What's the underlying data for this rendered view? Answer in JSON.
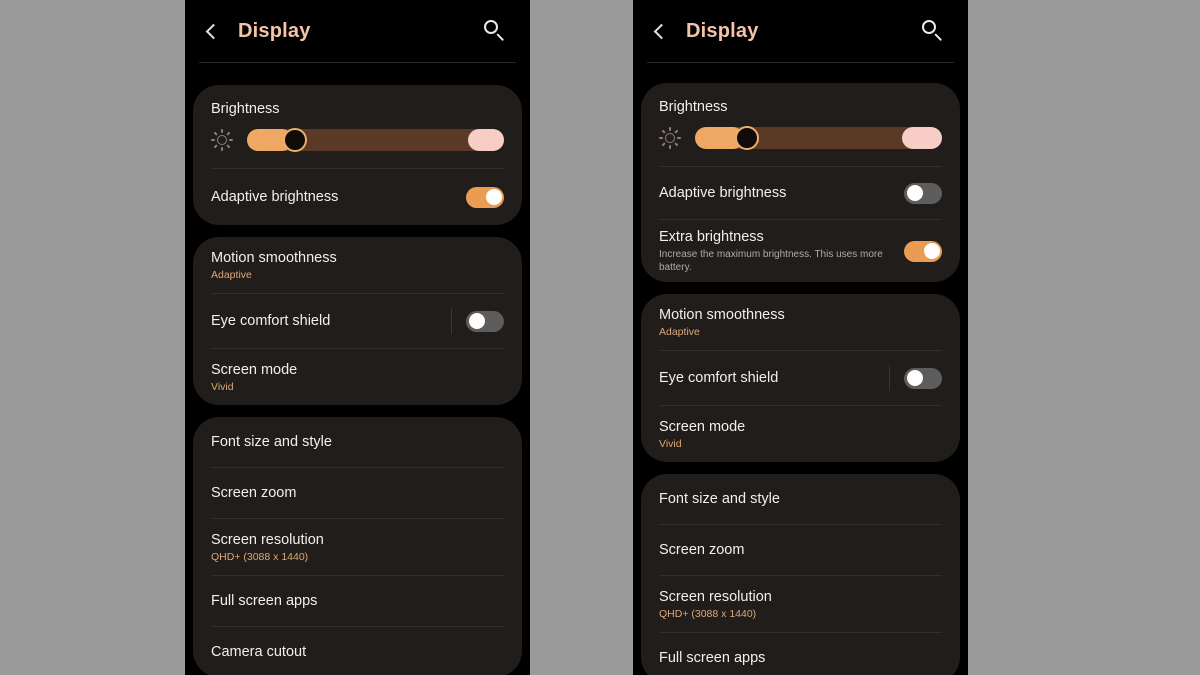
{
  "background_color": "#9a9a9a",
  "theme": {
    "screen_bg": "#000000",
    "card_bg": "#211d1a",
    "title_accent": "#f6c3a8",
    "sub_accent": "#dda878",
    "toggle_on": "#ea9d52",
    "toggle_off": "#5d5d5d",
    "slider_fill": "#efa863",
    "slider_track": "#5a3a26",
    "slider_cap": "#f7cdc6"
  },
  "left_phone": {
    "header": {
      "back_icon": "chevron-left-icon",
      "title": "Display",
      "search_icon": "search-icon"
    },
    "brightness": {
      "label": "Brightness",
      "icon": "brightness-sun-icon",
      "slider": {
        "fill_percent": 18,
        "knob_percent": 17,
        "cap_percent": 14
      }
    },
    "adaptive_brightness": {
      "label": "Adaptive brightness",
      "toggle": "on"
    },
    "card2": [
      {
        "label": "Motion smoothness",
        "sub": "Adaptive",
        "control": "none"
      },
      {
        "label": "Eye comfort shield",
        "sub": "",
        "control": "toggle",
        "toggle": "off",
        "divider_before_toggle": true
      },
      {
        "label": "Screen mode",
        "sub": "Vivid",
        "control": "none"
      }
    ],
    "card3": [
      {
        "label": "Font size and style",
        "sub": ""
      },
      {
        "label": "Screen zoom",
        "sub": ""
      },
      {
        "label": "Screen resolution",
        "sub": "QHD+ (3088 x 1440)"
      },
      {
        "label": "Full screen apps",
        "sub": ""
      },
      {
        "label": "Camera cutout",
        "sub": ""
      }
    ]
  },
  "right_phone": {
    "header": {
      "back_icon": "chevron-left-icon",
      "title": "Display",
      "search_icon": "search-icon"
    },
    "brightness": {
      "label": "Brightness",
      "icon": "brightness-sun-icon",
      "slider": {
        "fill_percent": 20,
        "knob_percent": 19,
        "cap_percent": 16
      }
    },
    "adaptive_brightness": {
      "label": "Adaptive brightness",
      "toggle": "off"
    },
    "extra_brightness": {
      "label": "Extra brightness",
      "desc": "Increase the maximum brightness. This uses more battery.",
      "toggle": "on"
    },
    "card2": [
      {
        "label": "Motion smoothness",
        "sub": "Adaptive",
        "control": "none"
      },
      {
        "label": "Eye comfort shield",
        "sub": "",
        "control": "toggle",
        "toggle": "off",
        "divider_before_toggle": true
      },
      {
        "label": "Screen mode",
        "sub": "Vivid",
        "control": "none"
      }
    ],
    "card3": [
      {
        "label": "Font size and style",
        "sub": ""
      },
      {
        "label": "Screen zoom",
        "sub": ""
      },
      {
        "label": "Screen resolution",
        "sub": "QHD+ (3088 x 1440)"
      },
      {
        "label": "Full screen apps",
        "sub": ""
      }
    ]
  }
}
